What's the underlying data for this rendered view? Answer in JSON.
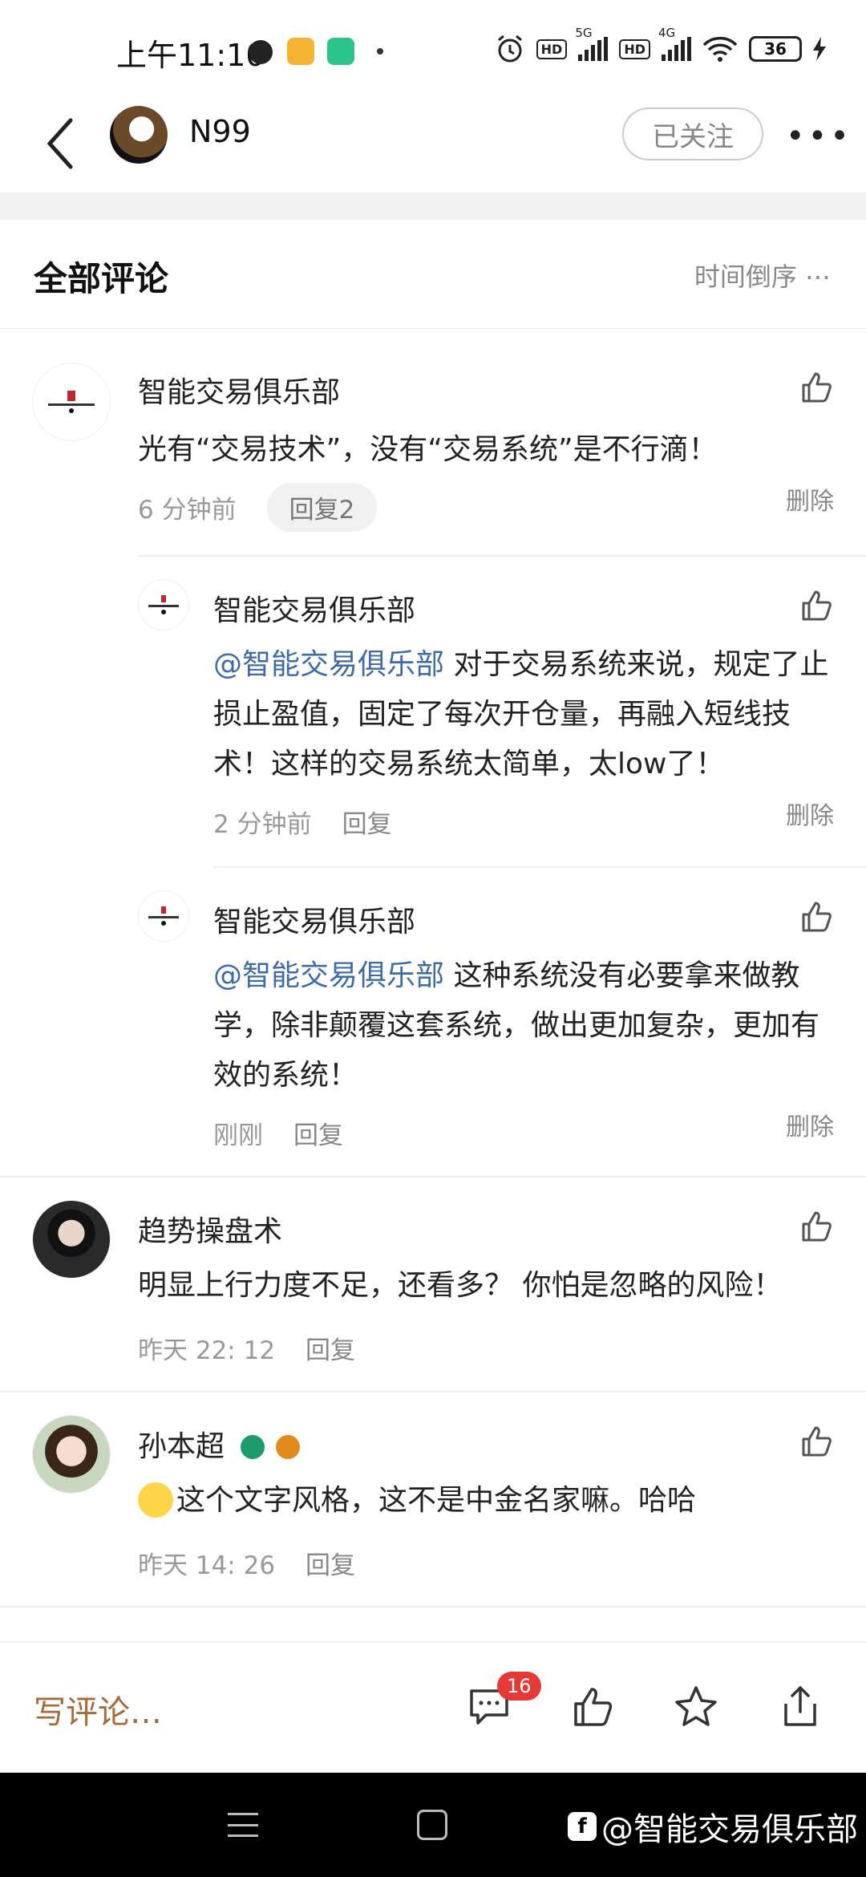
{
  "status_bar": {
    "time": "上午11:10",
    "network_1": "5G",
    "network_2": "4G",
    "hd": "HD",
    "battery": "36"
  },
  "header": {
    "username": "N99",
    "follow_label": "已关注",
    "more": "•••"
  },
  "comments_section": {
    "title": "全部评论",
    "sort_label": "时间倒序"
  },
  "comments": [
    {
      "name": "智能交易俱乐部",
      "text": "光有“交易技术”，没有“交易系统”是不行滴！",
      "time": "6 分钟前",
      "reply_label": "回复2",
      "delete_label": "删除",
      "replies": [
        {
          "name": "智能交易俱乐部",
          "mention": "@智能交易俱乐部",
          "text": " 对于交易系统来说，规定了止损止盈值，固定了每次开仓量，再融入短线技术！这样的交易系统太简单，太low了！",
          "time": "2 分钟前",
          "reply_label": "回复",
          "delete_label": "删除"
        },
        {
          "name": "智能交易俱乐部",
          "mention": "@智能交易俱乐部",
          "text": " 这种系统没有必要拿来做教学，除非颠覆这套系统，做出更加复杂，更加有效的系统！",
          "time": "刚刚",
          "reply_label": "回复",
          "delete_label": "删除"
        }
      ]
    },
    {
      "name": "趋势操盘术",
      "text": "明显上行力度不足，还看多？ 你怕是忽略的风险！",
      "time": "昨天 22: 12",
      "reply_label": "回复"
    },
    {
      "name": "孙本超",
      "text": "这个文字风格，这不是中金名家嘛。哈哈",
      "time": "昨天 14: 26",
      "reply_label": "回复"
    }
  ],
  "bottom_bar": {
    "write_placeholder": "写评论…",
    "comment_count": "16"
  },
  "watermark": "@智能交易俱乐部",
  "colors": {
    "mention": "#3d6ba6",
    "write_comment": "#a66b3a",
    "badge": "#e53935"
  }
}
